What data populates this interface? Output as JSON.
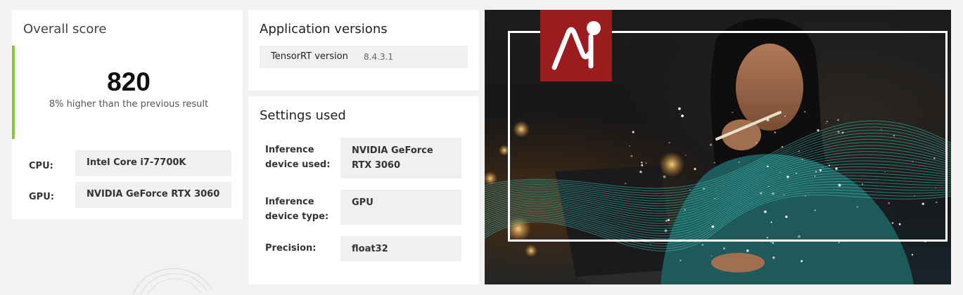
{
  "overall": {
    "title": "Overall score",
    "score": "820",
    "comparison": "8% higher than the previous result",
    "accent_color": "#8cc63f",
    "hardware": [
      {
        "label": "CPU:",
        "value": "Intel Core i7-7700K"
      },
      {
        "label": "GPU:",
        "value": "NVIDIA GeForce RTX 3060"
      }
    ]
  },
  "app_versions": {
    "title": "Application versions",
    "rows": [
      {
        "name": "TensorRT version",
        "value": "8.4.3.1"
      }
    ]
  },
  "settings": {
    "title": "Settings used",
    "rows": [
      {
        "label": "Inference device used:",
        "value": "NVIDIA GeForce RTX 3060"
      },
      {
        "label": "Inference device type:",
        "value": "GPU"
      },
      {
        "label": "Precision:",
        "value": "float32"
      }
    ]
  },
  "hero": {
    "logo_color": "#9b1b1f",
    "wave_color": "#3fc9c0",
    "logo_icon": "ai-logo-icon"
  }
}
